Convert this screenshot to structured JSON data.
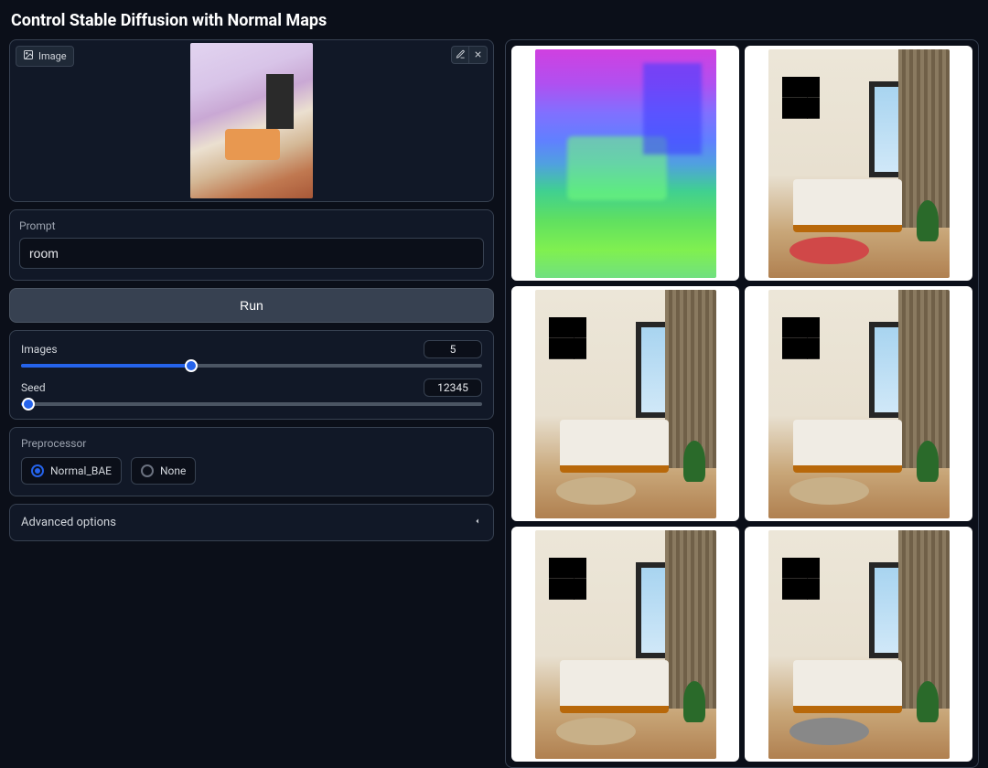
{
  "header": {
    "title": "Control Stable Diffusion with Normal Maps"
  },
  "upload": {
    "label": "Image"
  },
  "prompt": {
    "label": "Prompt",
    "value": "room"
  },
  "run": {
    "label": "Run"
  },
  "sliders": {
    "images": {
      "label": "Images",
      "value": "5",
      "fill_pct": 37
    },
    "seed": {
      "label": "Seed",
      "value": "12345",
      "fill_pct": 1.5
    }
  },
  "preprocessor": {
    "label": "Preprocessor",
    "options": [
      {
        "label": "Normal_BAE",
        "selected": true
      },
      {
        "label": "None",
        "selected": false
      }
    ]
  },
  "advanced": {
    "label": "Advanced options"
  },
  "gallery": {
    "items": [
      "normal-map",
      "bedroom-red-rug",
      "bedroom-beige-rug",
      "bedroom-cream-rug",
      "bedroom-white",
      "bedroom-grey-rug"
    ]
  }
}
